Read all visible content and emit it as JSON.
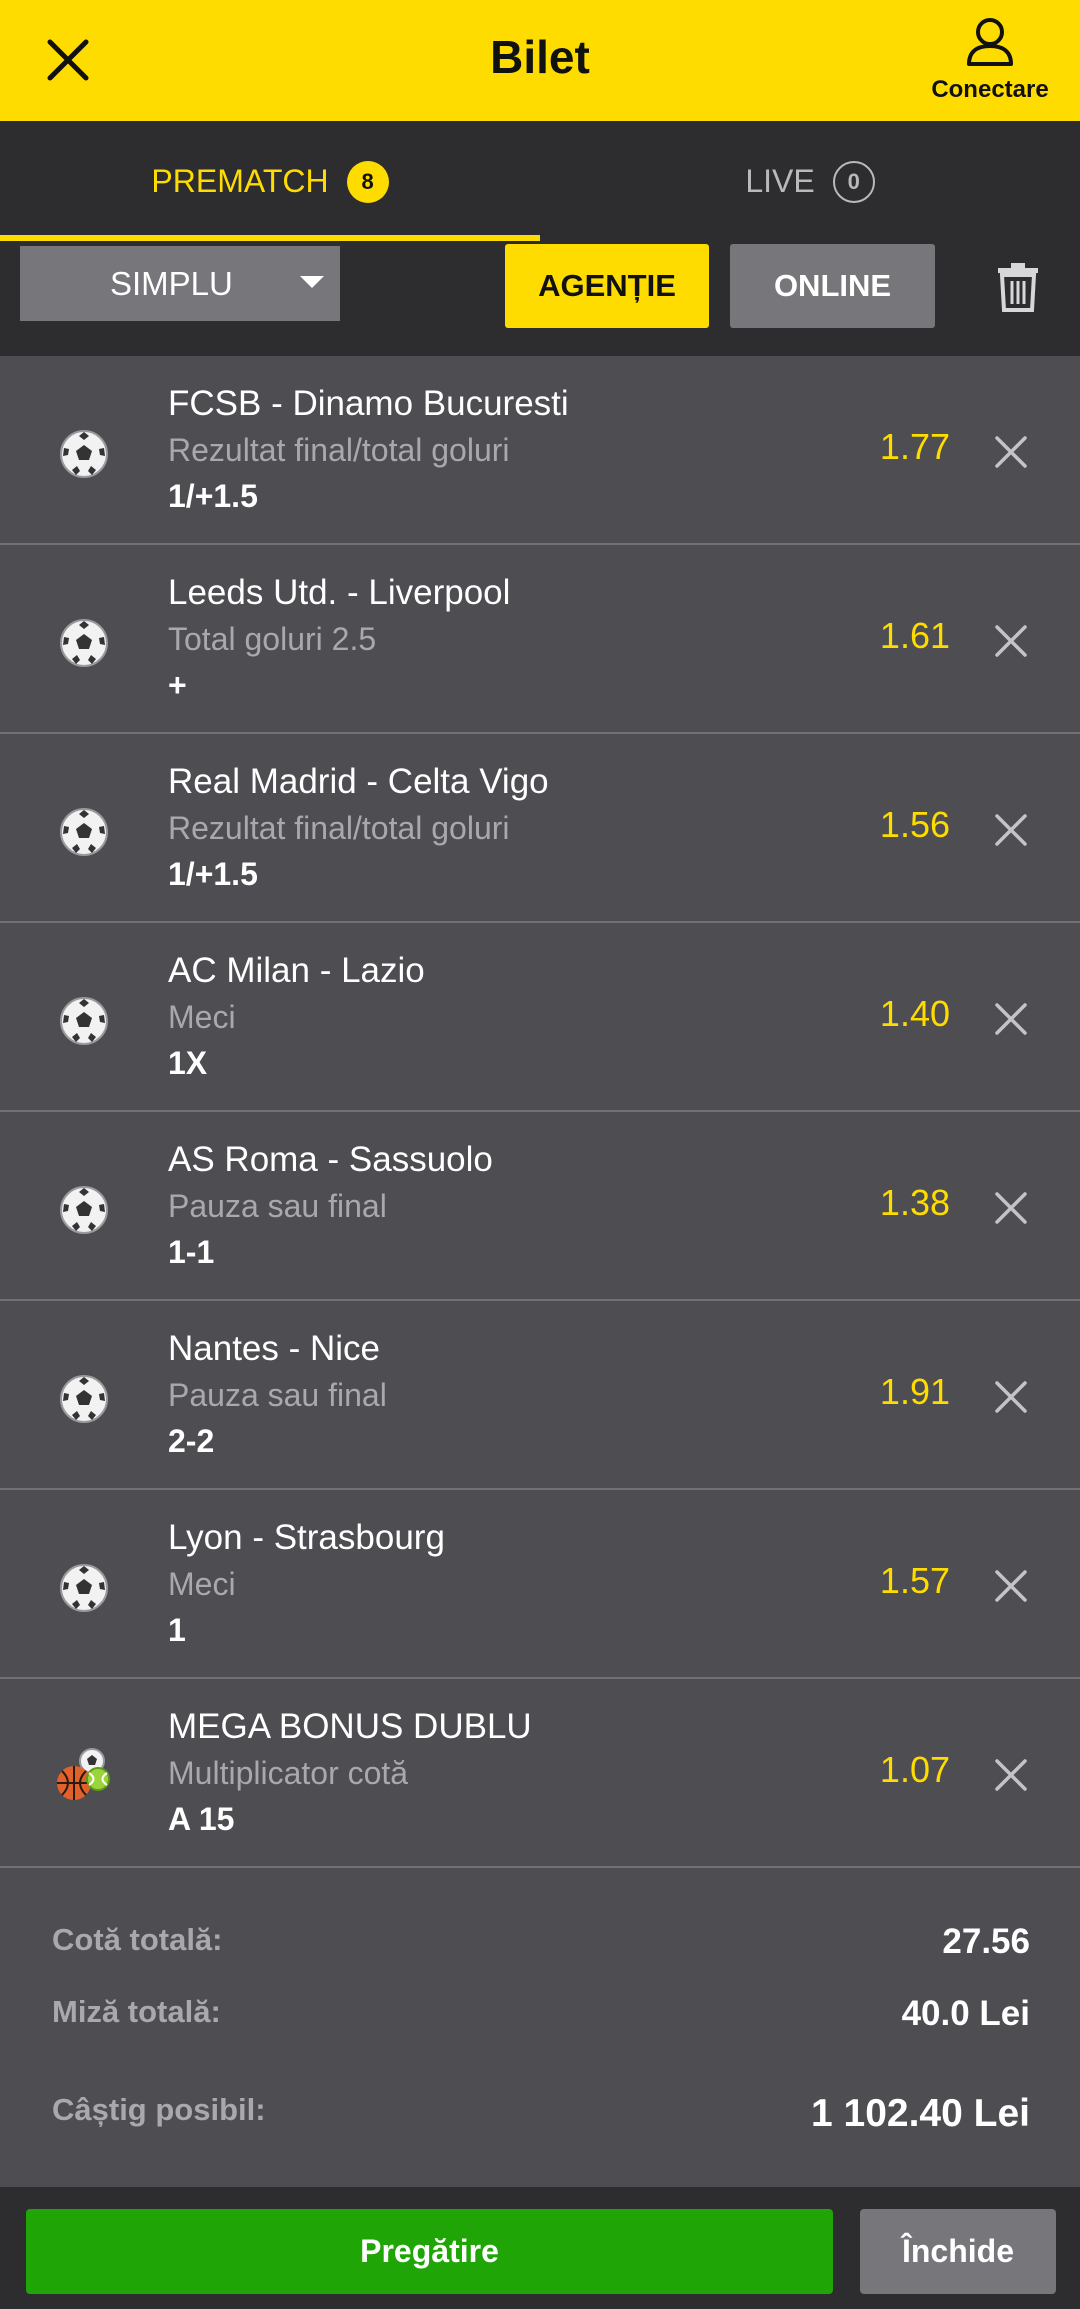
{
  "header": {
    "title": "Bilet",
    "close_icon": "close-icon",
    "login_label": "Conectare",
    "login_icon": "user-icon"
  },
  "tabs": [
    {
      "label": "PREMATCH",
      "count": "8",
      "active": true
    },
    {
      "label": "LIVE",
      "count": "0",
      "active": false
    }
  ],
  "toolbar": {
    "select_value": "SIMPLU",
    "agentie_label": "AGENȚIE",
    "online_label": "ONLINE",
    "trash_icon": "trash-icon"
  },
  "bets": [
    {
      "match": "FCSB - Dinamo Bucuresti",
      "market": "Rezultat final/total goluri",
      "pick": "1/+1.5",
      "odd": "1.77",
      "icon": "soccer-ball-icon"
    },
    {
      "match": "Leeds Utd. - Liverpool",
      "market": "Total goluri 2.5",
      "pick": "+",
      "odd": "1.61",
      "icon": "soccer-ball-icon"
    },
    {
      "match": "Real Madrid - Celta Vigo",
      "market": "Rezultat final/total goluri",
      "pick": "1/+1.5",
      "odd": "1.56",
      "icon": "soccer-ball-icon"
    },
    {
      "match": "AC Milan - Lazio",
      "market": "Meci",
      "pick": "1X",
      "odd": "1.40",
      "icon": "soccer-ball-icon"
    },
    {
      "match": "AS Roma - Sassuolo",
      "market": "Pauza sau final",
      "pick": "1-1",
      "odd": "1.38",
      "icon": "soccer-ball-icon"
    },
    {
      "match": "Nantes - Nice",
      "market": "Pauza sau final",
      "pick": "2-2",
      "odd": "1.91",
      "icon": "soccer-ball-icon"
    },
    {
      "match": "Lyon - Strasbourg",
      "market": "Meci",
      "pick": "1",
      "odd": "1.57",
      "icon": "soccer-ball-icon"
    },
    {
      "match": "MEGA BONUS DUBLU",
      "market": "Multiplicator cotă",
      "pick": "A 15",
      "odd": "1.07",
      "icon": "multi-sport-icon"
    }
  ],
  "summary": {
    "total_odds_label": "Cotă totală:",
    "total_odds_value": "27.56",
    "total_stake_label": "Miză totală:",
    "total_stake_value": "40.0  Lei",
    "possible_win_label": "Câștig posibil:",
    "possible_win_value": "1 102.40 Lei"
  },
  "footer": {
    "prepare_label": "Pregătire",
    "close_label": "Închide"
  },
  "colors": {
    "accent": "#ffdc00",
    "green": "#1fa506",
    "background": "#4d4d52",
    "dark": "#2d2d30"
  }
}
